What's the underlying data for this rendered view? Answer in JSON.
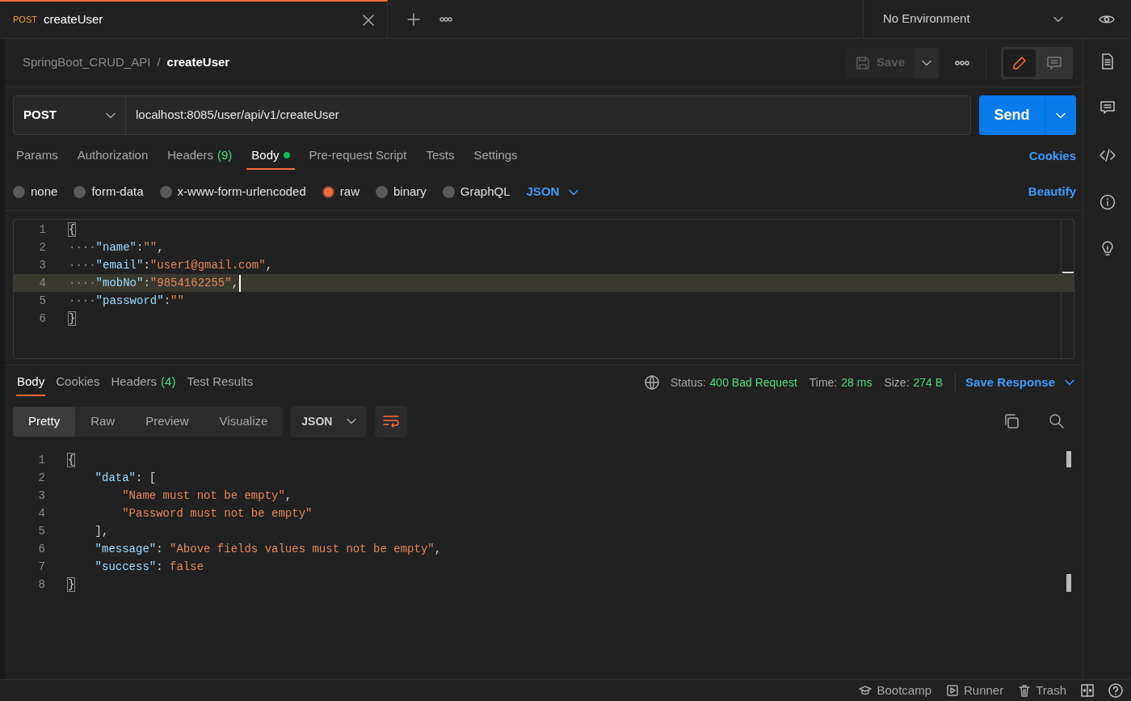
{
  "tabs": [
    {
      "method": "POST",
      "title": "createUser",
      "selected": true
    }
  ],
  "environment": "No Environment",
  "breadcrumb": {
    "collection": "SpringBoot_CRUD_API",
    "separator": "/",
    "request": "createUser"
  },
  "save_button": {
    "label": "Save",
    "disabled": true
  },
  "mode_toggle": [
    {
      "kind": "edit",
      "selected": true
    },
    {
      "kind": "comment",
      "selected": false
    }
  ],
  "request": {
    "method": "POST",
    "url": "localhost:8085/user/api/v1/createUser",
    "send": "Send"
  },
  "request_tabs": [
    {
      "label": "Params",
      "selected": false
    },
    {
      "label": "Authorization",
      "selected": false
    },
    {
      "label": "Headers",
      "count": "(9)",
      "selected": false
    },
    {
      "label": "Body",
      "selected": true,
      "dot": true
    },
    {
      "label": "Pre-request Script",
      "selected": false
    },
    {
      "label": "Tests",
      "selected": false
    },
    {
      "label": "Settings",
      "selected": false
    }
  ],
  "cookies_link": "Cookies",
  "body_types": [
    {
      "label": "none",
      "selected": false
    },
    {
      "label": "form-data",
      "selected": false
    },
    {
      "label": "x-www-form-urlencoded",
      "selected": false
    },
    {
      "label": "raw",
      "selected": true
    },
    {
      "label": "binary",
      "selected": false
    },
    {
      "label": "GraphQL",
      "selected": false
    }
  ],
  "body_format": "JSON",
  "beautify": "Beautify",
  "request_body": [
    {
      "number": "1",
      "current": false,
      "tokens": [
        {
          "kind": "brace",
          "text": "{"
        }
      ]
    },
    {
      "number": "2",
      "current": false,
      "tokens": [
        {
          "kind": "ws",
          "text": "····"
        },
        {
          "kind": "key",
          "text": "\"name\""
        },
        {
          "kind": "punct",
          "text": ":"
        },
        {
          "kind": "str",
          "text": "\"\""
        },
        {
          "kind": "punct",
          "text": ","
        }
      ]
    },
    {
      "number": "3",
      "current": false,
      "tokens": [
        {
          "kind": "ws",
          "text": "····"
        },
        {
          "kind": "key",
          "text": "\"email\""
        },
        {
          "kind": "punct",
          "text": ":"
        },
        {
          "kind": "str",
          "text": "\"user1@gmail.com\""
        },
        {
          "kind": "punct",
          "text": ","
        }
      ]
    },
    {
      "number": "4",
      "current": true,
      "tokens": [
        {
          "kind": "ws",
          "text": "····"
        },
        {
          "kind": "key",
          "text": "\"mobNo\""
        },
        {
          "kind": "punct",
          "text": ":"
        },
        {
          "kind": "str",
          "text": "\"9854162255\""
        },
        {
          "kind": "punct",
          "text": ","
        }
      ]
    },
    {
      "number": "5",
      "current": false,
      "tokens": [
        {
          "kind": "ws",
          "text": "····"
        },
        {
          "kind": "key",
          "text": "\"password\""
        },
        {
          "kind": "punct",
          "text": ":"
        },
        {
          "kind": "str",
          "text": "\"\""
        }
      ]
    },
    {
      "number": "6",
      "current": false,
      "tokens": [
        {
          "kind": "brace",
          "text": "}"
        }
      ]
    }
  ],
  "response_tabs": [
    {
      "label": "Body",
      "selected": true
    },
    {
      "label": "Cookies",
      "selected": false
    },
    {
      "label": "Headers",
      "count": "(4)",
      "selected": false
    },
    {
      "label": "Test Results",
      "selected": false
    }
  ],
  "response_meta": [
    {
      "label": "Status:",
      "value": "400 Bad Request"
    },
    {
      "label": "Time:",
      "value": "28 ms"
    },
    {
      "label": "Size:",
      "value": "274 B"
    }
  ],
  "save_response": "Save Response",
  "view_modes": [
    {
      "label": "Pretty",
      "selected": true
    },
    {
      "label": "Raw",
      "selected": false
    },
    {
      "label": "Preview",
      "selected": false
    },
    {
      "label": "Visualize",
      "selected": false
    }
  ],
  "response_format": "JSON",
  "response_body": [
    {
      "number": "1",
      "tokens": [
        {
          "kind": "brace",
          "text": "{"
        }
      ]
    },
    {
      "number": "2",
      "tokens": [
        {
          "kind": "key",
          "text": "    \"data\""
        },
        {
          "kind": "punct",
          "text": ": ["
        }
      ]
    },
    {
      "number": "3",
      "tokens": [
        {
          "kind": "str",
          "text": "        \"Name must not be empty\""
        },
        {
          "kind": "punct",
          "text": ","
        }
      ]
    },
    {
      "number": "4",
      "tokens": [
        {
          "kind": "str",
          "text": "        \"Password must not be empty\""
        }
      ]
    },
    {
      "number": "5",
      "tokens": [
        {
          "kind": "punct",
          "text": "    ],"
        }
      ]
    },
    {
      "number": "6",
      "tokens": [
        {
          "kind": "key",
          "text": "    \"message\""
        },
        {
          "kind": "punct",
          "text": ": "
        },
        {
          "kind": "str",
          "text": "\"Above fields values must not be empty\""
        },
        {
          "kind": "punct",
          "text": ","
        }
      ]
    },
    {
      "number": "7",
      "tokens": [
        {
          "kind": "key",
          "text": "    \"success\""
        },
        {
          "kind": "punct",
          "text": ": "
        },
        {
          "kind": "str",
          "text": "false"
        }
      ]
    },
    {
      "number": "8",
      "tokens": [
        {
          "kind": "brace",
          "text": "}"
        }
      ]
    }
  ],
  "status_bar": [
    {
      "kind": "bootcamp",
      "label": "Bootcamp"
    },
    {
      "kind": "runner",
      "label": "Runner"
    },
    {
      "kind": "trash",
      "label": "Trash"
    }
  ]
}
